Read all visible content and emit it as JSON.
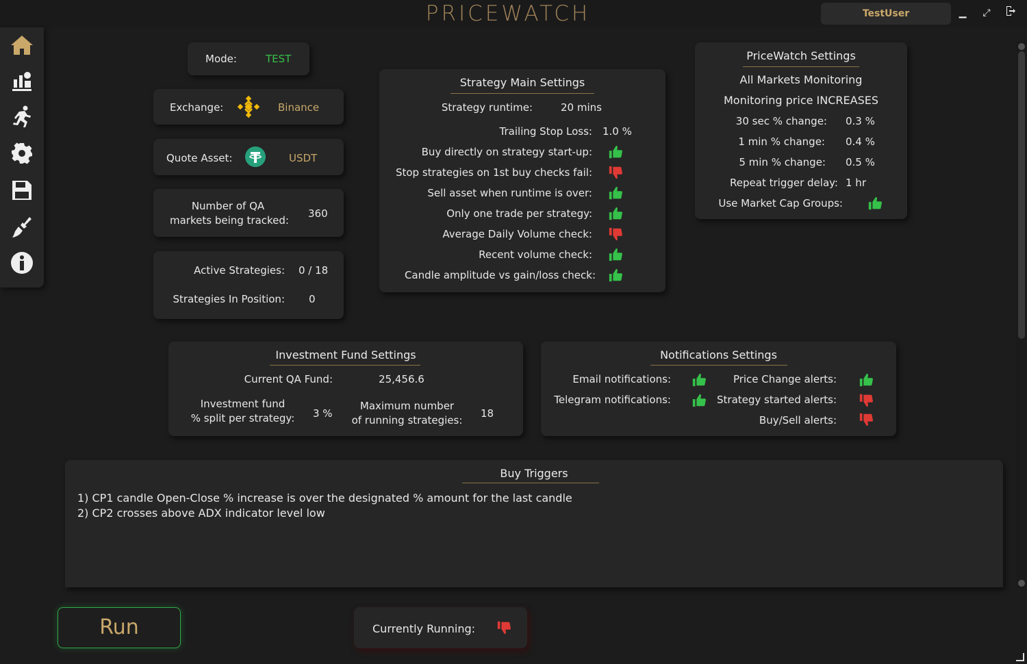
{
  "app": {
    "title": "PRICEWATCH",
    "user": "TestUser"
  },
  "window_controls": [
    "minimize-icon",
    "maximize-icon",
    "logout-icon"
  ],
  "sidebar": {
    "items": [
      {
        "icon": "home-icon"
      },
      {
        "icon": "stats-icon"
      },
      {
        "icon": "running-icon"
      },
      {
        "icon": "gear-icon"
      },
      {
        "icon": "save-icon"
      },
      {
        "icon": "broom-icon"
      },
      {
        "icon": "info-icon"
      }
    ]
  },
  "mode": {
    "label": "Mode:",
    "value": "TEST"
  },
  "exchange": {
    "label": "Exchange:",
    "value": "Binance",
    "icon": "binance-icon"
  },
  "quote_asset": {
    "label": "Quote Asset:",
    "value": "USDT",
    "icon": "tether-icon"
  },
  "qa_markets": {
    "label_line1": "Number of QA",
    "label_line2": "markets being tracked:",
    "value": "360"
  },
  "strategies": {
    "active_label": "Active Strategies:",
    "active_value": "0 / 18",
    "in_position_label": "Strategies In Position:",
    "in_position_value": "0"
  },
  "strategy_main": {
    "title": "Strategy Main Settings",
    "runtime_label": "Strategy runtime:",
    "runtime_value": "20 mins",
    "trailing_label": "Trailing Stop Loss:",
    "trailing_value": "1.0 %",
    "checks": [
      {
        "label": "Buy directly on strategy start-up:",
        "state": "up"
      },
      {
        "label": "Stop strategies on 1st buy checks fail:",
        "state": "down"
      },
      {
        "label": "Sell asset when runtime is over:",
        "state": "up"
      },
      {
        "label": "Only one trade per strategy:",
        "state": "up"
      },
      {
        "label": "Average Daily Volume check:",
        "state": "down"
      },
      {
        "label": "Recent volume check:",
        "state": "up"
      },
      {
        "label": "Candle amplitude vs gain/loss check:",
        "state": "up"
      }
    ]
  },
  "pricewatch_settings": {
    "title": "PriceWatch Settings",
    "line1": "All Markets Monitoring",
    "line2": "Monitoring price INCREASES",
    "rows": [
      {
        "label": "30 sec % change:",
        "value": "0.3 %"
      },
      {
        "label": "1 min % change:",
        "value": "0.4 %"
      },
      {
        "label": "5 min % change:",
        "value": "0.5 %"
      },
      {
        "label": "Repeat trigger delay:",
        "value": "1 hr"
      }
    ],
    "market_cap_label": "Use Market Cap Groups:",
    "market_cap_state": "up"
  },
  "investment": {
    "title": "Investment Fund Settings",
    "fund_label": "Current QA Fund:",
    "fund_value": "25,456.6",
    "split_label_line1": "Investment fund",
    "split_label_line2": "% split per strategy:",
    "split_value": "3 %",
    "max_label_line1": "Maximum number",
    "max_label_line2": "of running strategies:",
    "max_value": "18"
  },
  "notifications": {
    "title": "Notifications Settings",
    "email_label": "Email notifications:",
    "email_state": "up",
    "telegram_label": "Telegram notifications:",
    "telegram_state": "up",
    "price_change_label": "Price Change alerts:",
    "price_change_state": "up",
    "strategy_started_label": "Strategy started alerts:",
    "strategy_started_state": "down",
    "buysell_label": "Buy/Sell alerts:",
    "buysell_state": "down"
  },
  "buy_triggers": {
    "title": "Buy Triggers",
    "lines": [
      "1) CP1 candle Open-Close % increase is over the designated % amount for the last candle",
      "2) CP2 crosses above ADX indicator level low"
    ]
  },
  "run_button": {
    "label": "Run"
  },
  "currently_running": {
    "label": "Currently Running:",
    "state": "down"
  },
  "colors": {
    "accent_gold": "#c9a86a",
    "thumb_up": "#35c14a",
    "thumb_down": "#e03a35",
    "card_bg": "#262626",
    "page_bg": "#1c1c1c"
  }
}
